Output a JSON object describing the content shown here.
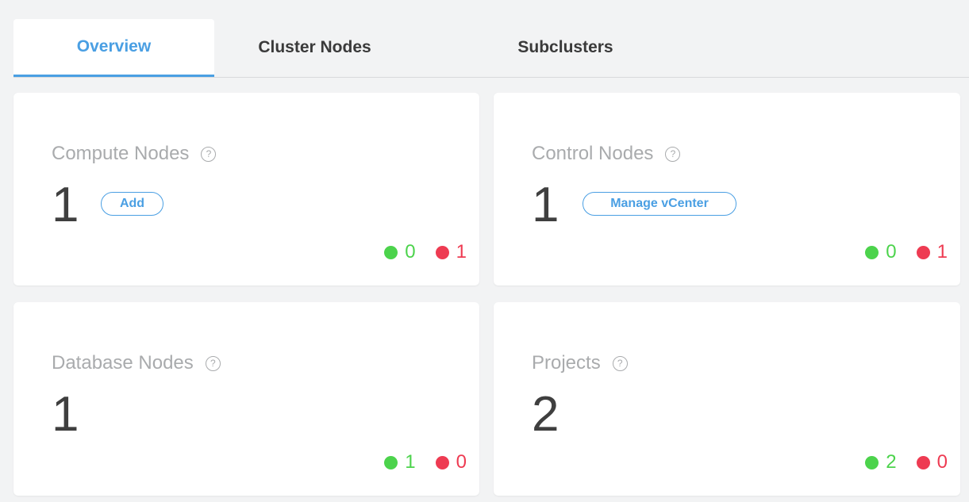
{
  "tabs": [
    {
      "label": "Overview",
      "active": true
    },
    {
      "label": "Cluster Nodes",
      "active": false
    },
    {
      "label": "Subclusters",
      "active": false
    }
  ],
  "help_icon_glyph": "?",
  "cards": [
    {
      "title": "Compute Nodes",
      "count": "1",
      "button": "Add",
      "ok": "0",
      "bad": "1"
    },
    {
      "title": "Control Nodes",
      "count": "1",
      "button": "Manage vCenter",
      "ok": "0",
      "bad": "1"
    },
    {
      "title": "Database Nodes",
      "count": "1",
      "ok": "1",
      "bad": "0"
    },
    {
      "title": "Projects",
      "count": "2",
      "ok": "2",
      "bad": "0"
    }
  ],
  "colors": {
    "accent": "#4a9fe3",
    "ok": "#4cd34c",
    "bad": "#ee3b52",
    "title": "#a9abad",
    "count": "#3f3f3f"
  },
  "icons": {
    "help": "question-circle-icon",
    "ok_status": "green-dot-icon",
    "bad_status": "red-dot-icon"
  }
}
